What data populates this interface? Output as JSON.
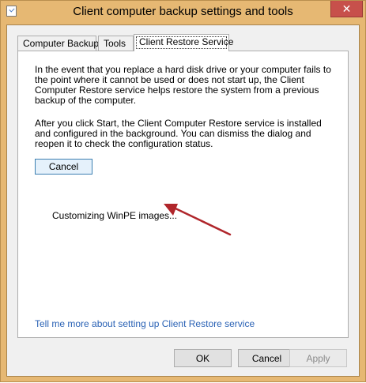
{
  "window": {
    "title": "Client computer backup settings and tools",
    "close_glyph": "✕",
    "accent_color": "#e6b873"
  },
  "tabs": [
    {
      "label": "Computer Backup",
      "active": false
    },
    {
      "label": "Tools",
      "active": false
    },
    {
      "label": "Client Restore Service",
      "active": true
    }
  ],
  "content": {
    "paragraph1": "In the event that you replace a hard disk drive or your computer fails to the point where it cannot be used or does not start up, the Client Computer Restore service helps restore the system from a previous backup of the computer.",
    "paragraph2": "After you click Start, the Client Computer Restore service is installed and configured in the background. You can dismiss the dialog and reopen it to check the configuration status.",
    "cancel_label": "Cancel",
    "status_text": "Customizing WinPE images...",
    "help_link": "Tell me more about setting up Client Restore service"
  },
  "footer": {
    "ok_label": "OK",
    "cancel_label": "Cancel",
    "apply_label": "Apply"
  },
  "annotation": {
    "arrow_color": "#b0262b"
  }
}
